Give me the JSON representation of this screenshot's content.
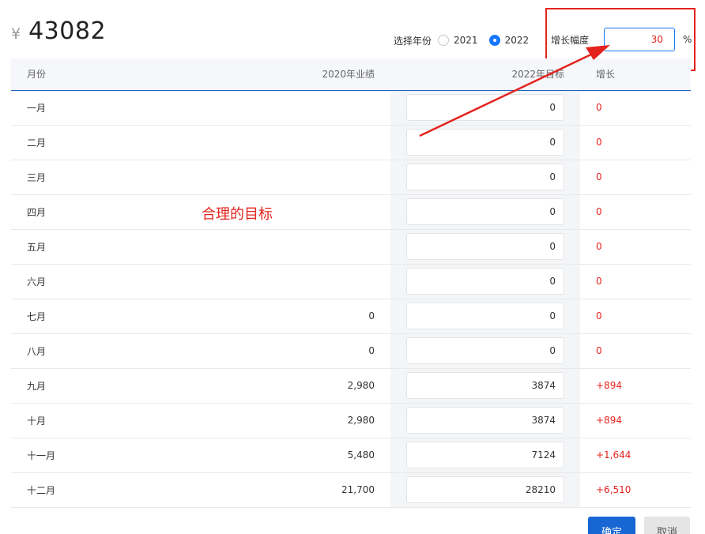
{
  "summary": {
    "currency": "¥",
    "total": "43082"
  },
  "year_select": {
    "label": "选择年份",
    "options": [
      {
        "label": "2021",
        "selected": false
      },
      {
        "label": "2022",
        "selected": true
      }
    ]
  },
  "growth": {
    "label": "增长幅度",
    "value": "30",
    "unit": "%"
  },
  "table": {
    "headers": {
      "month": "月份",
      "prev": "2020年业绩",
      "target": "2022年目标",
      "growth": "增长"
    },
    "rows": [
      {
        "month": "一月",
        "prev": "",
        "target": "0",
        "growth": "0"
      },
      {
        "month": "二月",
        "prev": "",
        "target": "0",
        "growth": "0"
      },
      {
        "month": "三月",
        "prev": "",
        "target": "0",
        "growth": "0"
      },
      {
        "month": "四月",
        "prev": "",
        "target": "0",
        "growth": "0"
      },
      {
        "month": "五月",
        "prev": "",
        "target": "0",
        "growth": "0"
      },
      {
        "month": "六月",
        "prev": "",
        "target": "0",
        "growth": "0"
      },
      {
        "month": "七月",
        "prev": "0",
        "target": "0",
        "growth": "0"
      },
      {
        "month": "八月",
        "prev": "0",
        "target": "0",
        "growth": "0"
      },
      {
        "month": "九月",
        "prev": "2,980",
        "target": "3874",
        "growth": "+894"
      },
      {
        "month": "十月",
        "prev": "2,980",
        "target": "3874",
        "growth": "+894"
      },
      {
        "month": "十一月",
        "prev": "5,480",
        "target": "7124",
        "growth": "+1,644"
      },
      {
        "month": "十二月",
        "prev": "21,700",
        "target": "28210",
        "growth": "+6,510"
      }
    ]
  },
  "annotation": {
    "text": "合理的目标",
    "color": "#e5231e"
  },
  "buttons": {
    "confirm": "确定",
    "cancel": "取消"
  },
  "colors": {
    "accent": "#1677ff",
    "alert": "#e5231e",
    "primary_button": "#1766d4"
  }
}
